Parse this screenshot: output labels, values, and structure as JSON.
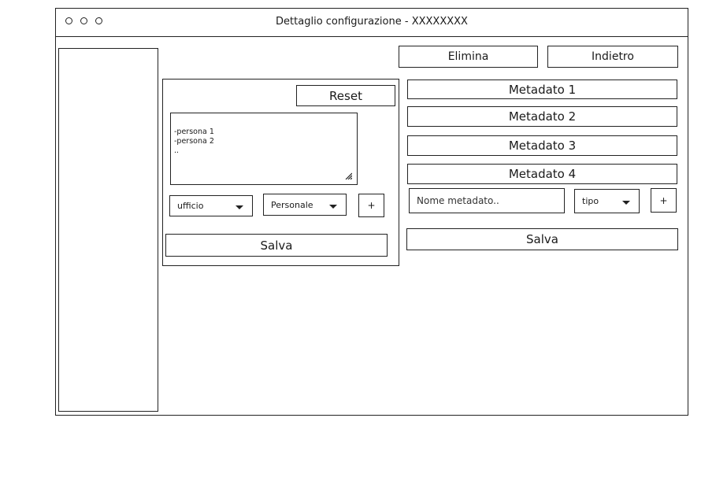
{
  "window": {
    "title": "Dettaglio configurazione - XXXXXXXX"
  },
  "toolbar": {
    "delete_label": "Elimina",
    "back_label": "Indietro"
  },
  "persons_panel": {
    "reset_label": "Reset",
    "textarea_value": "-persona 1\n-persona 2\n..",
    "office_select": "ufficio",
    "personal_select": "Personale",
    "add_label": "+",
    "save_label": "Salva"
  },
  "metadata_panel": {
    "items": [
      {
        "label": "Metadato 1"
      },
      {
        "label": "Metadato 2"
      },
      {
        "label": "Metadato 3"
      },
      {
        "label": "Metadato 4"
      }
    ],
    "name_placeholder": "Nome metadato..",
    "type_select": "tipo",
    "add_label": "+",
    "save_label": "Salva"
  }
}
